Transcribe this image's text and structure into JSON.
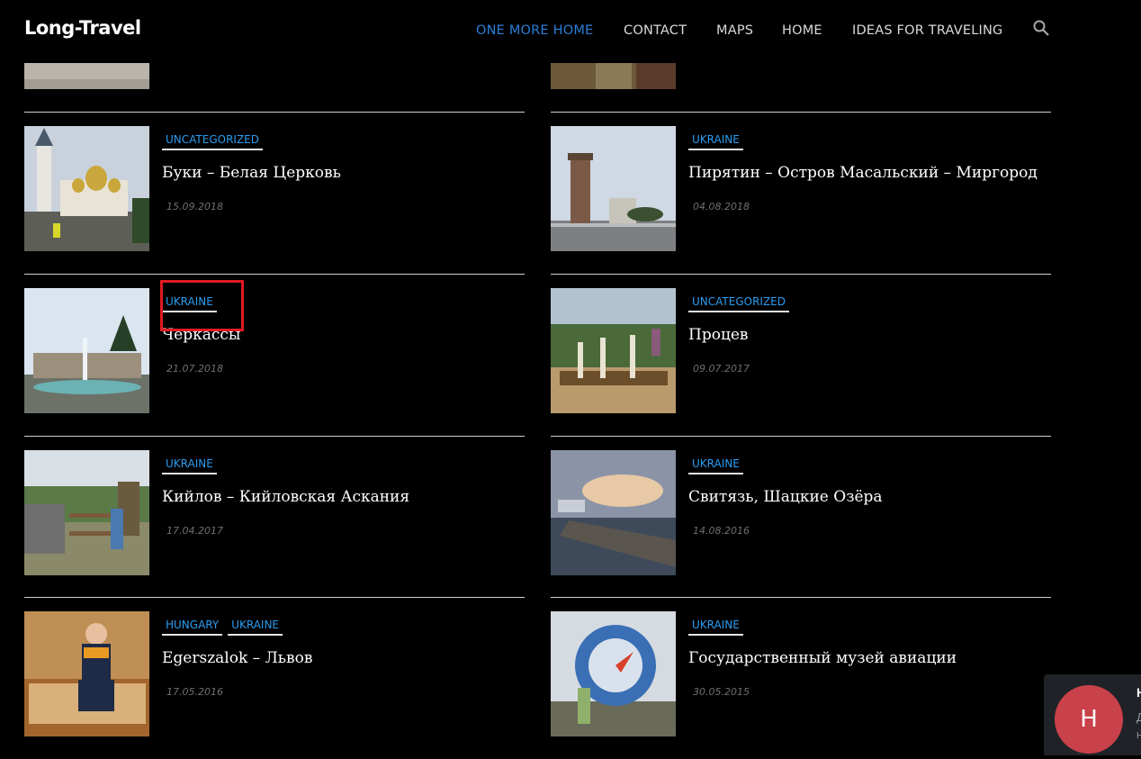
{
  "site": {
    "logo": "Long-Travel"
  },
  "nav": {
    "items": [
      {
        "label": "ONE MORE HOME"
      },
      {
        "label": "CONTACT"
      },
      {
        "label": "MAPS"
      },
      {
        "label": "HOME"
      },
      {
        "label": "IDEAS FOR TRAVELING"
      }
    ],
    "search_icon": "search-icon"
  },
  "posts": [
    {
      "cats": [
        "UNCATEGORIZED"
      ],
      "title": "Буки – Белая Церковь",
      "date": "15.09.2018"
    },
    {
      "cats": [
        "UKRAINE"
      ],
      "title": "Пирятин – Остров Масальский – Миргород",
      "date": "04.08.2018"
    },
    {
      "cats": [
        "UKRAINE"
      ],
      "title": "Черкассы",
      "date": "21.07.2018"
    },
    {
      "cats": [
        "UNCATEGORIZED"
      ],
      "title": "Процев",
      "date": "09.07.2017"
    },
    {
      "cats": [
        "UKRAINE"
      ],
      "title": "Кийлов – Кийловская Аскания",
      "date": "17.04.2017"
    },
    {
      "cats": [
        "UKRAINE"
      ],
      "title": "Свитязь, Шацкие Озёра",
      "date": "14.08.2016"
    },
    {
      "cats": [
        "HUNGARY",
        "UKRAINE"
      ],
      "title": "Egerszalok – Львов",
      "date": "17.05.2016"
    },
    {
      "cats": [
        "UKRAINE"
      ],
      "title": "Государственный музей авиации",
      "date": "30.05.2015"
    }
  ],
  "notification": {
    "avatar_letter": "H",
    "line1": "Н",
    "line2": "Д",
    "line3": "Н"
  },
  "colors": {
    "accent": "#2c9cf0",
    "active_nav": "#2a7ed8",
    "highlight": "#e01b22"
  }
}
